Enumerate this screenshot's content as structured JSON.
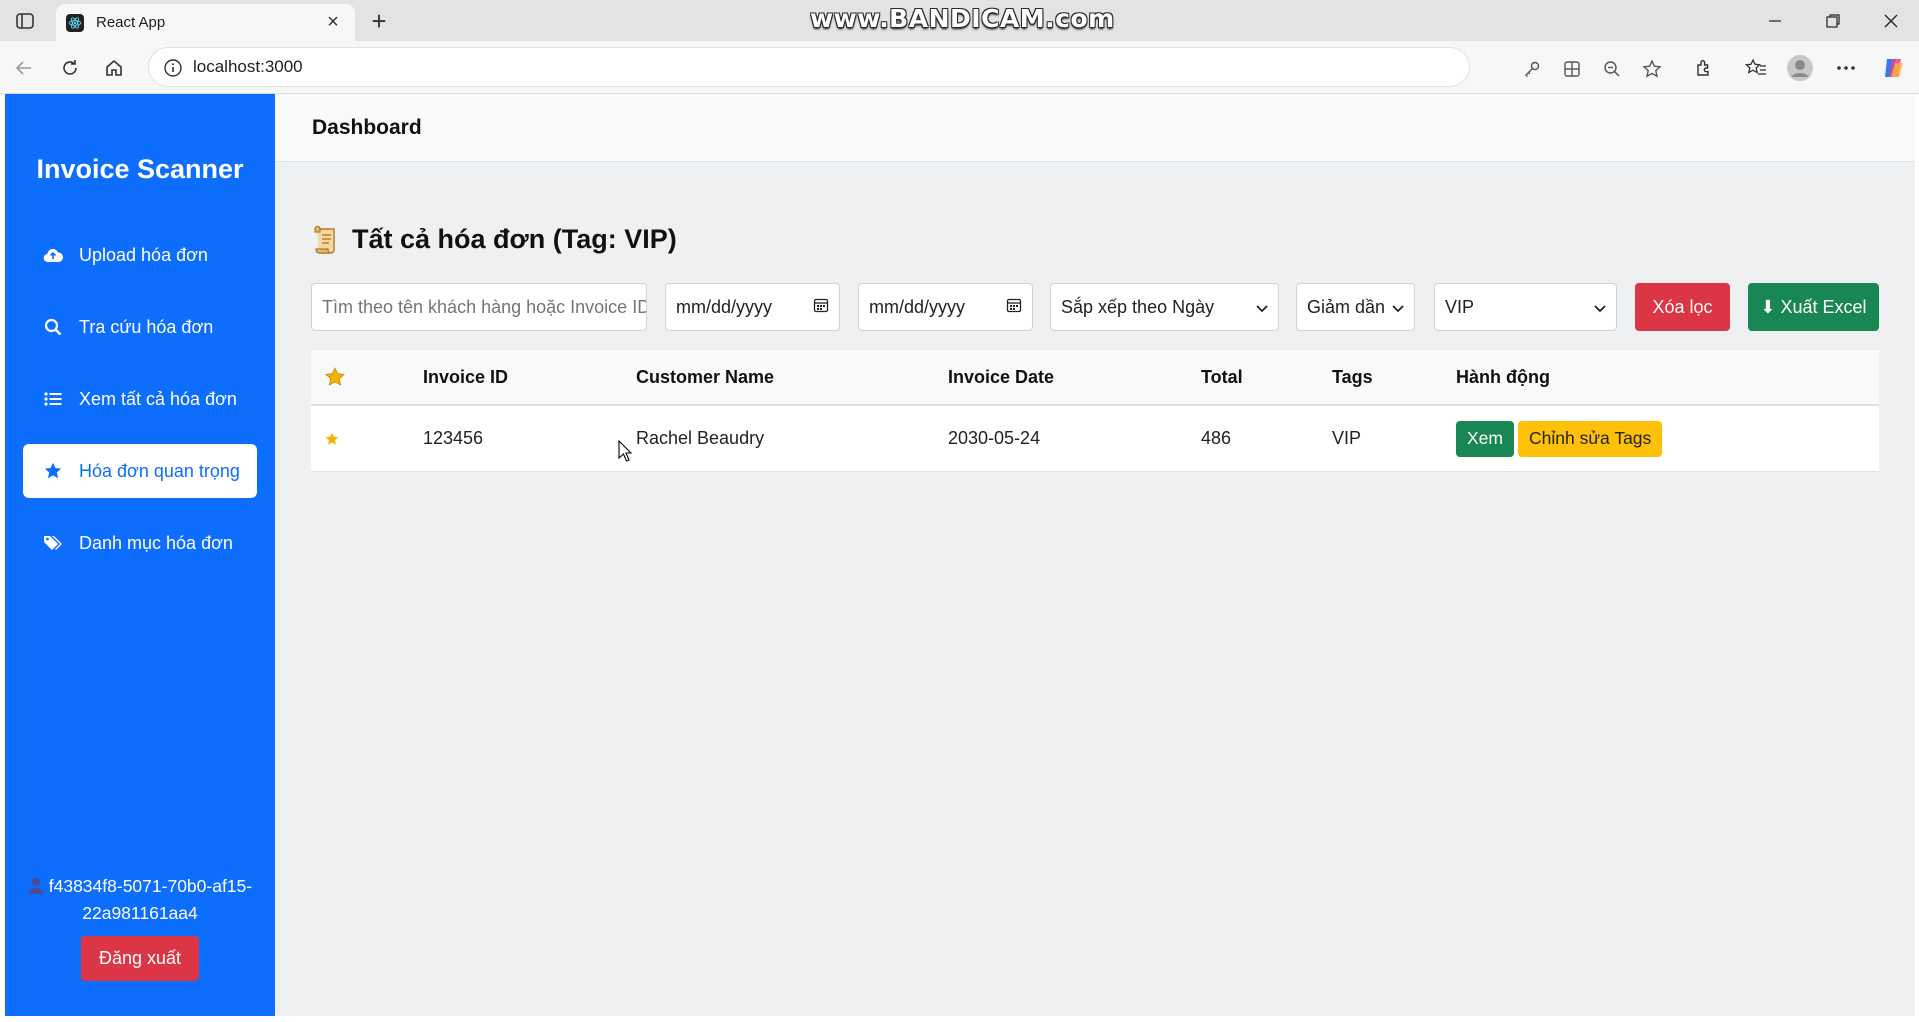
{
  "browser": {
    "tab_title": "React App",
    "url": "localhost:3000",
    "watermark": "www.BANDICAM.com"
  },
  "sidebar": {
    "brand": "Invoice Scanner",
    "items": [
      {
        "label": "Upload hóa đơn",
        "icon": "cloud-upload-icon",
        "active": false
      },
      {
        "label": "Tra cứu hóa đơn",
        "icon": "search-icon",
        "active": false
      },
      {
        "label": "Xem tất cả hóa đơn",
        "icon": "list-icon",
        "active": false
      },
      {
        "label": "Hóa đơn quan trọng",
        "icon": "star-icon",
        "active": true
      },
      {
        "label": "Danh mục hóa đơn",
        "icon": "tags-icon",
        "active": false
      }
    ],
    "user_id": "f43834f8-5071-70b0-af15-22a981161aa4",
    "logout_label": "Đăng xuất"
  },
  "header": {
    "title": "Dashboard"
  },
  "page": {
    "title": "Tất cả hóa đơn (Tag: VIP)"
  },
  "filters": {
    "search_placeholder": "Tìm theo tên khách hàng hoặc Invoice ID",
    "date_from": "mm/dd/yyyy",
    "date_to": "mm/dd/yyyy",
    "sort_by": "Sắp xếp theo Ngày",
    "sort_order": "Giảm dần",
    "tag": "VIP",
    "clear_label": "Xóa lọc",
    "export_label": "⬇ Xuất Excel"
  },
  "table": {
    "columns": [
      "Invoice ID",
      "Customer Name",
      "Invoice Date",
      "Total",
      "Tags",
      "Hành động"
    ],
    "rows": [
      {
        "starred": true,
        "invoice_id": "123456",
        "customer_name": "Rachel Beaudry",
        "invoice_date": "2030-05-24",
        "total": "486",
        "tags": "VIP"
      }
    ],
    "view_label": "Xem",
    "edit_tags_label": "Chỉnh sửa Tags"
  },
  "colors": {
    "primary": "#0d6efd",
    "danger": "#dc3545",
    "success": "#198754",
    "warning": "#ffc107",
    "star": "#f5b301"
  }
}
